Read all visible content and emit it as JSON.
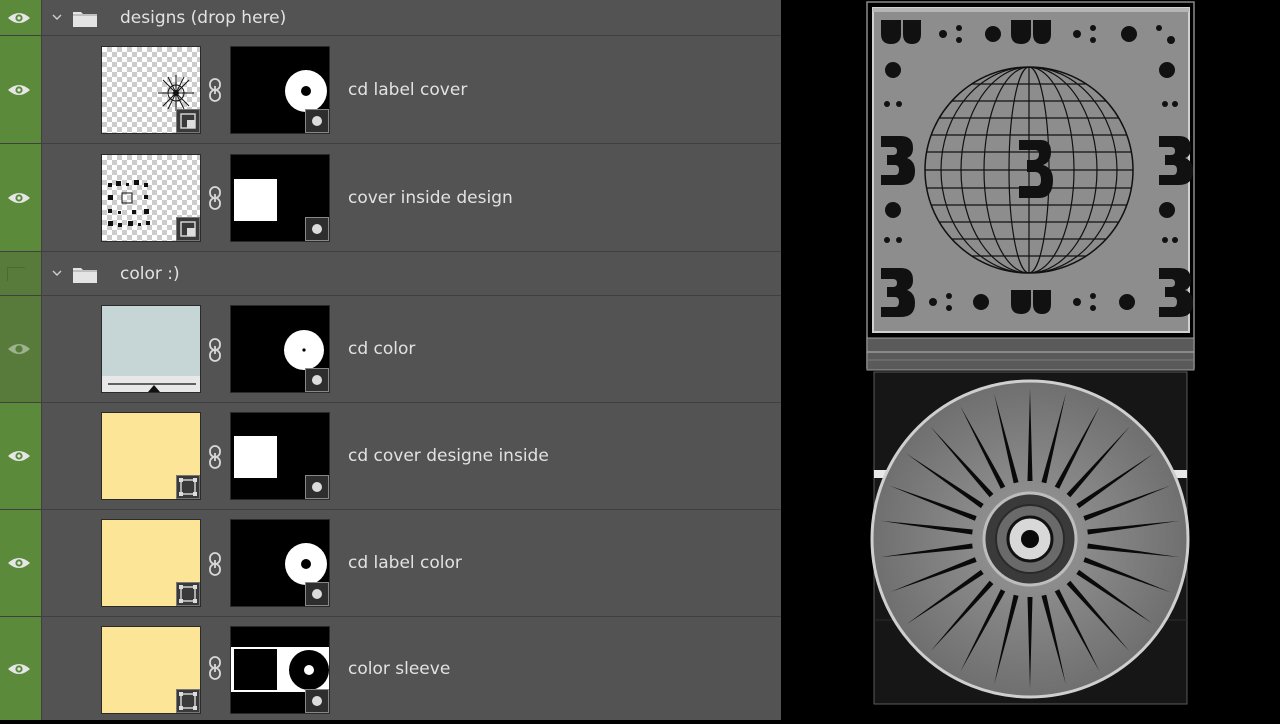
{
  "layers_panel": {
    "groups": [
      {
        "label": "designs (drop here)",
        "icon": "folder-icon",
        "expanded": true,
        "visible": true
      },
      {
        "label": "color :)",
        "icon": "folder-icon",
        "expanded": true,
        "visible": false
      }
    ],
    "layers": [
      {
        "label": "cd label cover",
        "thumbnail": "transparent-artwork",
        "badge": "smart-object-icon",
        "mask": "disc-mask"
      },
      {
        "label": "cover inside design",
        "thumbnail": "transparent-artwork",
        "badge": "smart-object-icon",
        "mask": "square-mask"
      },
      {
        "label": "cd color",
        "thumbnail": "gradient-swatch",
        "badge": "gradient-icon",
        "mask": "disc-mask"
      },
      {
        "label": "cd cover designe inside",
        "thumbnail": "solid-swatch",
        "badge": "solid-color-icon",
        "mask": "square-mask"
      },
      {
        "label": "cd label color",
        "thumbnail": "solid-swatch",
        "badge": "solid-color-icon",
        "mask": "disc-mask"
      },
      {
        "label": "color sleeve",
        "thumbnail": "solid-swatch",
        "badge": "solid-color-icon",
        "mask": "sleeve-mask"
      }
    ]
  },
  "colors": {
    "panel_bg": "#535353",
    "visibility_column": "#5b8a3b",
    "swatch_light_blue": "#c6d6d6",
    "swatch_yellow": "#fde598",
    "canvas_bg": "#000000",
    "mockup_gray": "#8a8a8a"
  },
  "preview": {
    "description_icon": "cd-mockup-preview",
    "cover_graphic": "wireframe-globe-with-3",
    "disc_graphic": "radiating-petals-disc"
  }
}
